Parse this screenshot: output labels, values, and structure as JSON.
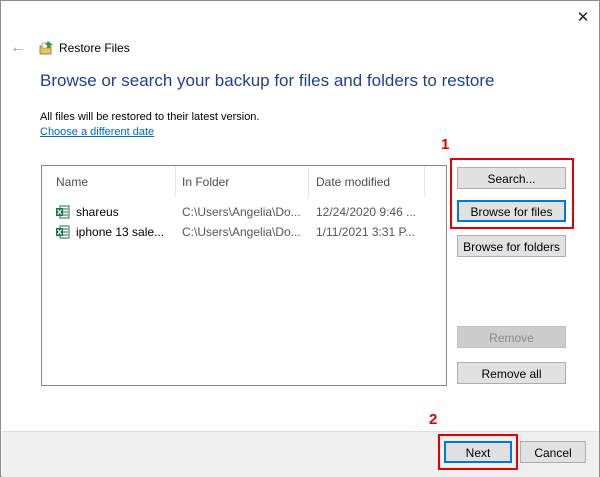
{
  "window": {
    "title": "Restore Files",
    "close_glyph": "✕",
    "back_glyph": "←"
  },
  "heading": "Browse or search your backup for files and folders to restore",
  "info_text": "All files will be restored to their latest version.",
  "change_date_link": "Choose a different date",
  "table": {
    "columns": [
      "Name",
      "In Folder",
      "Date modified"
    ],
    "rows": [
      {
        "name": "shareus",
        "folder": "C:\\Users\\Angelia\\Do...",
        "date": "12/24/2020 9:46 ...",
        "icon": "excel-file-icon"
      },
      {
        "name": "iphone 13 sale...",
        "folder": "C:\\Users\\Angelia\\Do...",
        "date": "1/11/2021 3:31 P...",
        "icon": "excel-file-icon"
      }
    ]
  },
  "buttons": {
    "search": "Search...",
    "browse_files": "Browse for files",
    "browse_folders": "Browse for folders",
    "remove": "Remove",
    "remove_all": "Remove all",
    "next": "Next",
    "cancel": "Cancel"
  },
  "annotations": {
    "step1": "1",
    "step2": "2",
    "highlight_color": "#e60000"
  },
  "colors": {
    "heading": "#1f3f8f",
    "link": "#0066cc",
    "excel_green": "#1e7145"
  }
}
